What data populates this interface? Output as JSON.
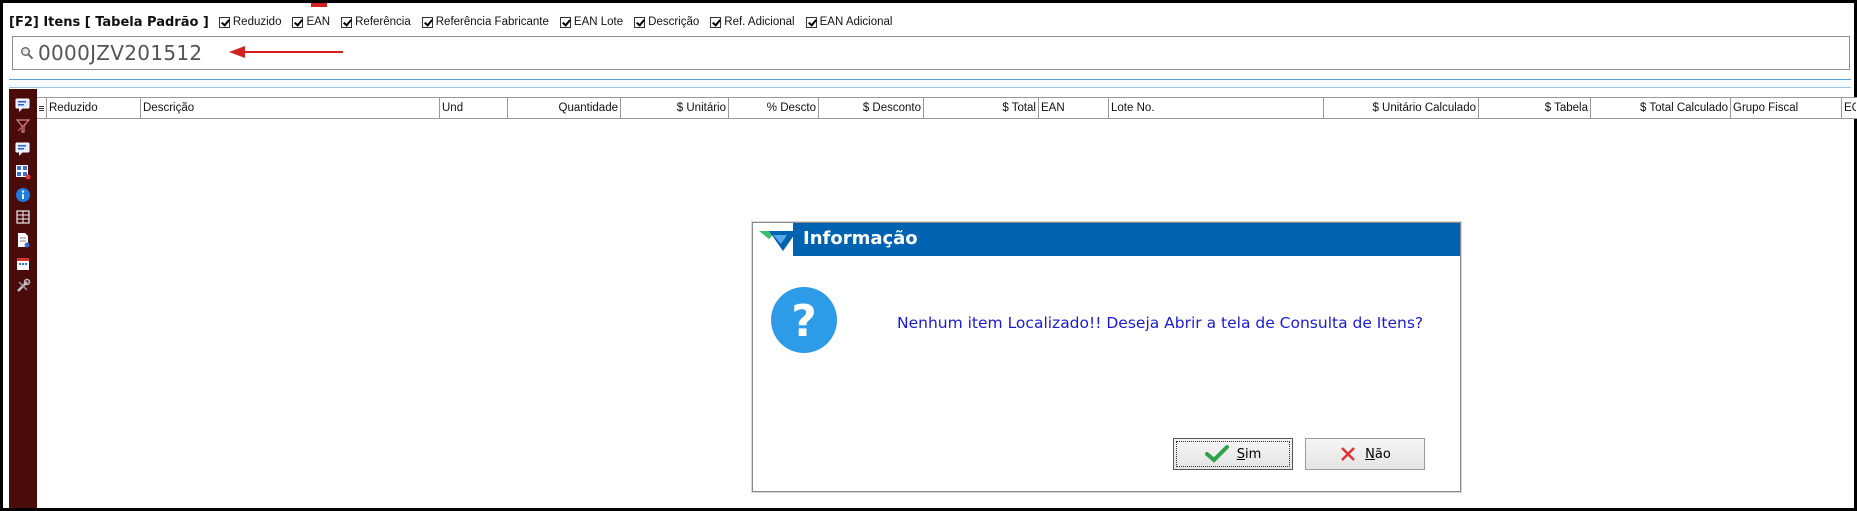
{
  "filter_bar": {
    "title": "[F2] Itens [ Tabela Padrão ]",
    "options": [
      {
        "label": "Reduzido",
        "checked": true
      },
      {
        "label": "EAN",
        "checked": true
      },
      {
        "label": "Referência",
        "checked": true
      },
      {
        "label": "Referência Fabricante",
        "checked": true
      },
      {
        "label": "EAN Lote",
        "checked": true
      },
      {
        "label": "Descrição",
        "checked": true
      },
      {
        "label": "Ref. Adicional",
        "checked": true
      },
      {
        "label": "EAN Adicional",
        "checked": true
      }
    ]
  },
  "search": {
    "value": "0000JZV201512",
    "icon": "search-icon"
  },
  "annotation": {
    "arrow_color": "#d21f1f"
  },
  "toolbar": {
    "icons": [
      "comment-icon",
      "clear-filter-icon",
      "comment-edit-icon",
      "grid-icon",
      "info-icon",
      "table-icon",
      "document-icon",
      "calendar-icon",
      "tools-icon"
    ]
  },
  "grid": {
    "columns": [
      {
        "label": "Reduzido"
      },
      {
        "label": "Descrição"
      },
      {
        "label": "Und"
      },
      {
        "label": "Quantidade"
      },
      {
        "label": "$ Unitário"
      },
      {
        "label": "% Descto"
      },
      {
        "label": "$ Desconto"
      },
      {
        "label": "$ Total"
      },
      {
        "label": "EAN"
      },
      {
        "label": "Lote No."
      },
      {
        "label": "$ Unitário Calculado"
      },
      {
        "label": "$ Tabela"
      },
      {
        "label": "$ Total Calculado"
      },
      {
        "label": "Grupo Fiscal"
      },
      {
        "label": "EC"
      }
    ]
  },
  "dialog": {
    "title": "Informação",
    "message": "Nenhum item Localizado!! Deseja Abrir a tela de Consulta de Itens?",
    "buttons": {
      "yes": {
        "label": "Sim",
        "mnemonic": "S",
        "rest": "im"
      },
      "no": {
        "label": "Não",
        "mnemonic": "N",
        "rest": "ão"
      }
    },
    "colors": {
      "title_bar": "#0063b1",
      "message_text": "#1b1bd6",
      "question_icon": "#2e9be8"
    }
  }
}
